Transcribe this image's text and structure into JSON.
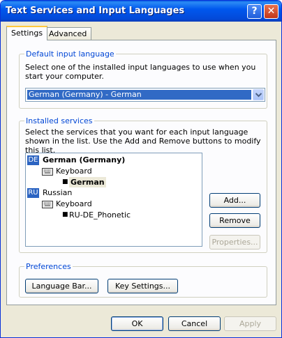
{
  "window": {
    "title": "Text Services and Input Languages"
  },
  "titlebar_buttons": {
    "help": "?",
    "close": "✕"
  },
  "tabs": [
    {
      "label": "Settings"
    },
    {
      "label": "Advanced"
    }
  ],
  "default_input_language": {
    "group_label": "Default input language",
    "description": "Select one of the installed input languages to use when you start your computer.",
    "selected_value": "German (Germany) - German"
  },
  "installed_services": {
    "group_label": "Installed services",
    "description": "Select the services that you want for each input language shown in the list. Use the Add and Remove buttons to modify this list.",
    "languages": [
      {
        "badge": "DE",
        "name": "German (Germany)",
        "category": "Keyboard",
        "layout": "German"
      },
      {
        "badge": "RU",
        "name": "Russian",
        "category": "Keyboard",
        "layout": "RU-DE_Phonetic"
      }
    ],
    "buttons": {
      "add": "Add...",
      "remove": "Remove",
      "properties": "Properties..."
    }
  },
  "preferences": {
    "group_label": "Preferences",
    "language_bar": "Language Bar...",
    "key_settings": "Key Settings..."
  },
  "footer": {
    "ok": "OK",
    "cancel": "Cancel",
    "apply": "Apply"
  },
  "colors": {
    "title_bar": "#0058ee",
    "selection": "#316ac5",
    "group_label": "#0046d5",
    "dialog_bg": "#ece9d8"
  }
}
